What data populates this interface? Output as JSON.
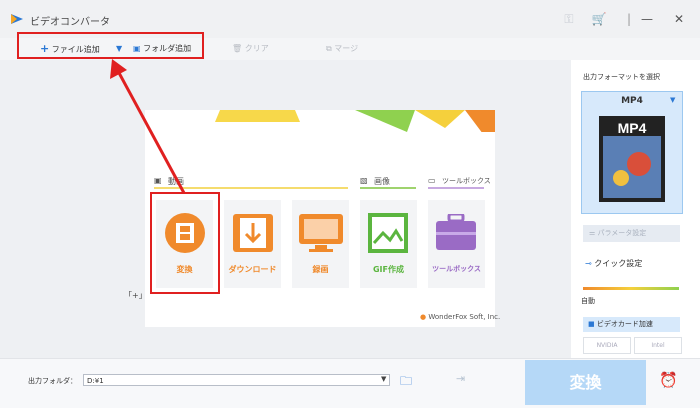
{
  "app": {
    "title": "ビデオコンバータ"
  },
  "toolbar": {
    "add_file": "ファイル追加",
    "add_folder": "フォルダ追加",
    "clear": "クリア",
    "merge": "マージ"
  },
  "hint": {
    "shortcut": "「+」 ?"
  },
  "sections": {
    "video": "動画",
    "image": "画像",
    "toolbox": "ツールボックス"
  },
  "tiles": [
    {
      "label": "変換",
      "color": "#f08a2c"
    },
    {
      "label": "ダウンロード",
      "color": "#f08a2c"
    },
    {
      "label": "録画",
      "color": "#f08a2c"
    },
    {
      "label": "GIF作成",
      "color": "#5bb53f"
    },
    {
      "label": "ツールボックス",
      "color": "#9a6bc5"
    }
  ],
  "brand": {
    "footer": "WonderFox Soft, Inc."
  },
  "right": {
    "format_heading": "出力フォーマットを選択",
    "format_value": "MP4",
    "param_settings": "パラメータ設定",
    "quick_settings": "クイック設定",
    "auto": "自動",
    "gpu_accel": "ビデオカード加速",
    "nvidia": "NVIDIA",
    "intel": "Intel"
  },
  "bottom": {
    "output_label": "出力フォルダ：",
    "output_path": "D:¥1",
    "convert": "変換"
  },
  "colors": {
    "accent": "#2b78d4",
    "highlight": "#e02020",
    "orange": "#f08a2c"
  }
}
